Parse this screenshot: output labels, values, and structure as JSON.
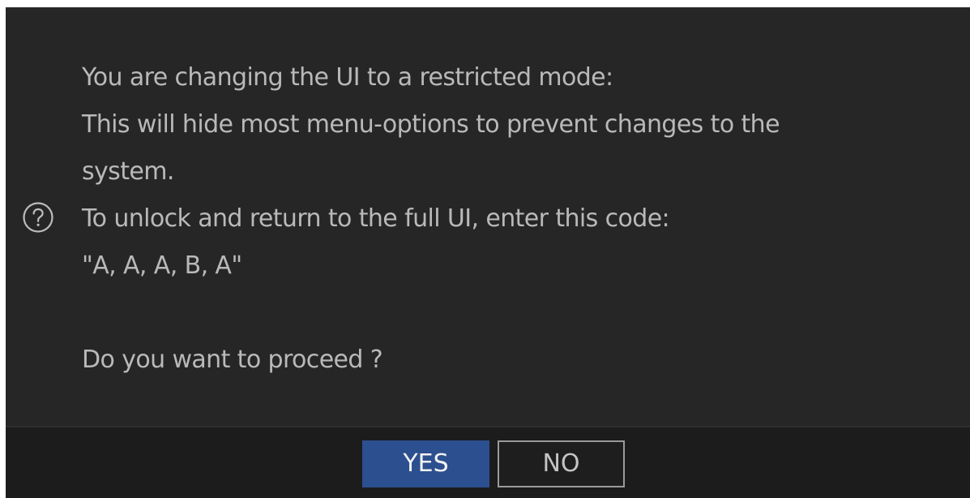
{
  "dialog": {
    "icon": "question-circle-icon",
    "lines": [
      "You are changing the UI to a restricted mode:",
      "This will hide most menu-options to prevent changes to the",
      "system.",
      "To unlock and return to the full UI, enter this code:",
      "\"A, A, A, B, A\"",
      "",
      "Do you want to proceed ?"
    ],
    "buttons": {
      "yes_label": "YES",
      "no_label": "NO"
    },
    "colors": {
      "background": "#262626",
      "button_bar": "#1c1c1c",
      "text": "#b9b9b9",
      "accent": "#2c4f8f",
      "no_border": "#9a9a9a"
    }
  }
}
